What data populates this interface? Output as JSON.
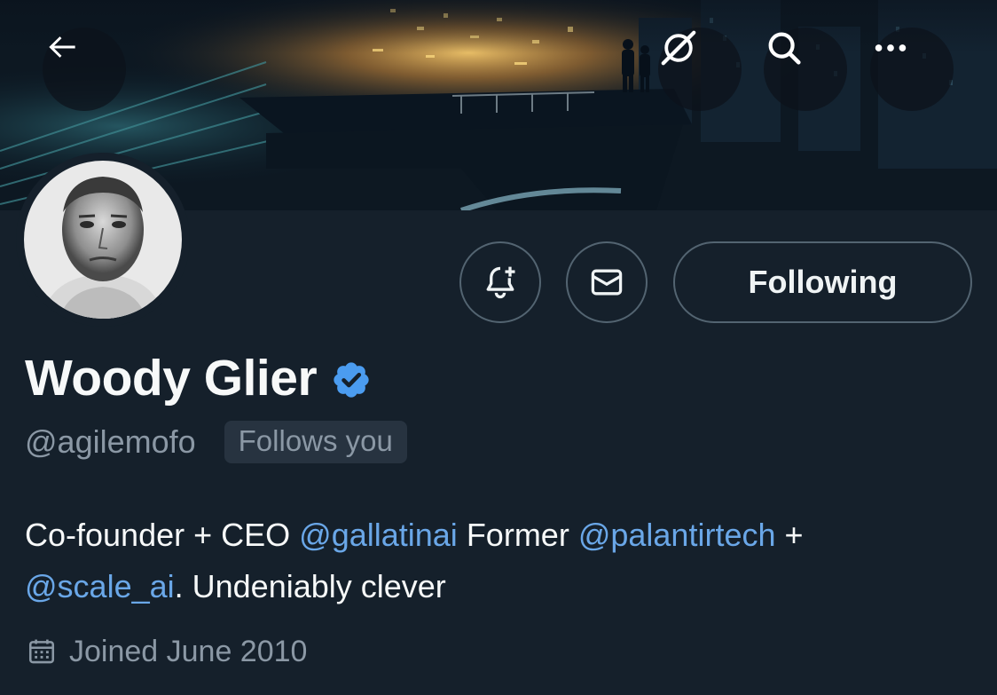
{
  "header": {
    "icons": {
      "back": "back-arrow-icon",
      "grok": "grok-icon",
      "search": "search-icon",
      "more": "more-icon"
    }
  },
  "profile": {
    "display_name": "Woody Glier",
    "verified": true,
    "handle": "@agilemofo",
    "follows_you_label": "Follows you",
    "bio": {
      "t1": "Co-founder + CEO ",
      "m1": "@gallatinai",
      "t2": " Former ",
      "m2": "@palantirtech",
      "t3": " +",
      "m3": "@scale_ai",
      "t4": ". Undeniably clever"
    },
    "joined": "Joined June 2010"
  },
  "actions": {
    "following_label": "Following",
    "notify_icon": "bell-plus-icon",
    "message_icon": "envelope-icon"
  },
  "colors": {
    "background": "#15202b",
    "text_primary": "#f7f9f9",
    "text_secondary": "#8b98a5",
    "link": "#6aa7e8",
    "verified": "#4b9cf0",
    "border": "#536471"
  }
}
